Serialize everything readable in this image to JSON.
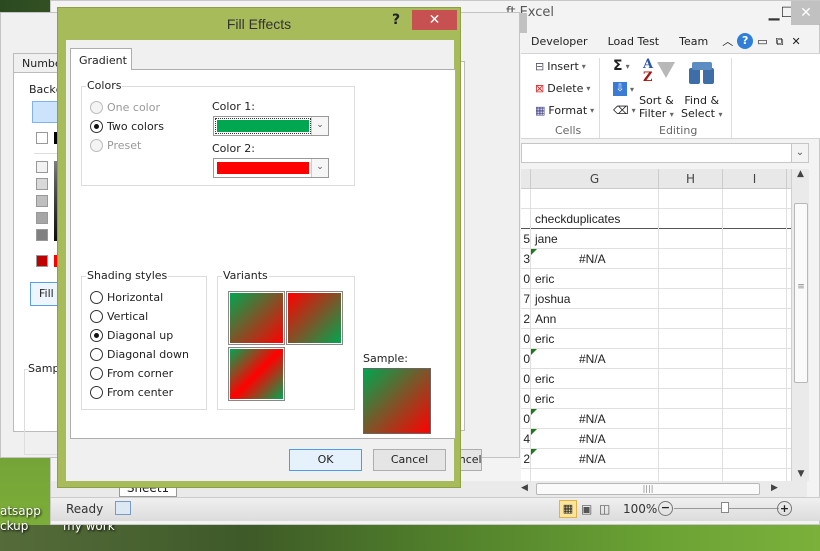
{
  "desktop": {
    "icons": [
      "atsapp ckup",
      "my work"
    ],
    "icon_label_1_line1": "atsapp",
    "icon_label_1_line2": "ckup",
    "icon_label_2": "my work"
  },
  "excel": {
    "title_partial": "ft Excel",
    "ribbon_tabs": [
      "Developer",
      "Load Test",
      "Team"
    ],
    "cells_group": {
      "label": "Cells",
      "insert": "Insert",
      "delete": "Delete",
      "format": "Format"
    },
    "editing_group": {
      "label": "Editing",
      "sort_filter": "Sort & Filter",
      "sort_line1": "Sort &",
      "sort_line2": "Filter",
      "find_select_line1": "Find &",
      "find_select_line2": "Select",
      "sigma": "Σ"
    },
    "columns": [
      "G",
      "H",
      "I"
    ],
    "rows": [
      {
        "prev": "",
        "g": "",
        "error": false
      },
      {
        "prev": "",
        "g": "checkduplicates",
        "error": false
      },
      {
        "prev": "5",
        "g": "jane",
        "error": false
      },
      {
        "prev": "3",
        "g": "#N/A",
        "error": true
      },
      {
        "prev": "0",
        "g": "eric",
        "error": false
      },
      {
        "prev": "7",
        "g": "joshua",
        "error": false
      },
      {
        "prev": "2",
        "g": "Ann",
        "error": false
      },
      {
        "prev": "0",
        "g": "eric",
        "error": false
      },
      {
        "prev": "0",
        "g": "#N/A",
        "error": true
      },
      {
        "prev": "0",
        "g": "eric",
        "error": false
      },
      {
        "prev": "0",
        "g": "eric",
        "error": false
      },
      {
        "prev": "0",
        "g": "#N/A",
        "error": true
      },
      {
        "prev": "4",
        "g": "#N/A",
        "error": true
      },
      {
        "prev": "2",
        "g": "#N/A",
        "error": true
      },
      {
        "prev": "",
        "g": "",
        "error": false
      }
    ],
    "sheet_tab": "Sheet1",
    "status": "Ready",
    "zoom": "100%"
  },
  "format_cells": {
    "tab": "Number",
    "background_label": "Backg",
    "fill_effects_button": "Fill E",
    "sample_label": "Sample",
    "cancel_partial": "ancel"
  },
  "fill_effects": {
    "title": "Fill Effects",
    "help": "?",
    "close": "✕",
    "tab": "Gradient",
    "colors_group": "Colors",
    "color_options": [
      {
        "label": "One color",
        "checked": false,
        "disabled": true
      },
      {
        "label": "Two colors",
        "checked": true,
        "disabled": false
      },
      {
        "label": "Preset",
        "checked": false,
        "disabled": true
      }
    ],
    "color1_label": "Color 1:",
    "color1_value": "#00a650",
    "color2_label": "Color 2:",
    "color2_value": "#ff0000",
    "shading_group": "Shading styles",
    "shading_options": [
      {
        "label": "Horizontal",
        "checked": false
      },
      {
        "label": "Vertical",
        "checked": false
      },
      {
        "label": "Diagonal up",
        "checked": true
      },
      {
        "label": "Diagonal down",
        "checked": false
      },
      {
        "label": "From corner",
        "checked": false
      },
      {
        "label": "From center",
        "checked": false
      }
    ],
    "variants_group": "Variants",
    "sample_label": "Sample:",
    "ok": "OK",
    "cancel": "Cancel"
  }
}
